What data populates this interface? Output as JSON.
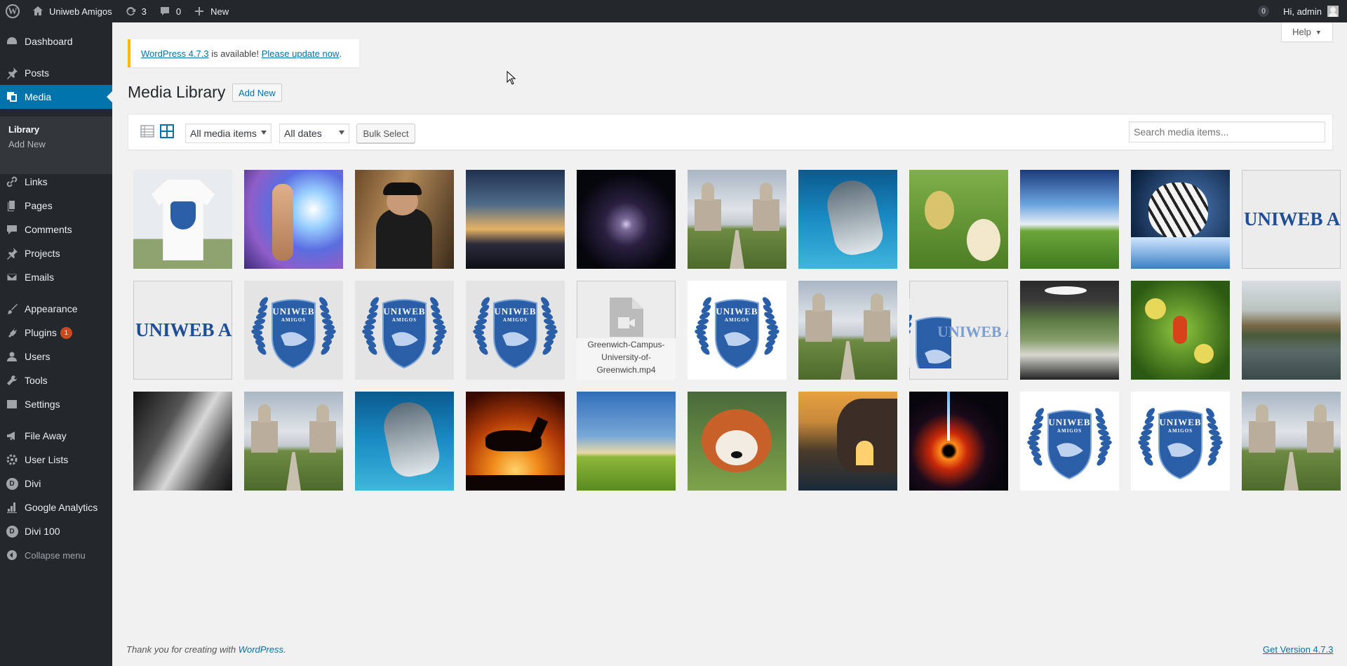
{
  "adminbar": {
    "site_name": "Uniweb Amigos",
    "updates_count": "3",
    "comments_count": "0",
    "new_label": "New",
    "notifications_count": "0",
    "greeting": "Hi, admin"
  },
  "sidebar": {
    "items": [
      {
        "label": "Dashboard",
        "icon": "dashboard-icon"
      },
      {
        "label": "Posts",
        "icon": "pin-icon"
      },
      {
        "label": "Media",
        "icon": "media-icon"
      },
      {
        "label": "Links",
        "icon": "link-icon"
      },
      {
        "label": "Pages",
        "icon": "pages-icon"
      },
      {
        "label": "Comments",
        "icon": "comment-icon"
      },
      {
        "label": "Projects",
        "icon": "pin-icon"
      },
      {
        "label": "Emails",
        "icon": "envelope-icon"
      },
      {
        "label": "Appearance",
        "icon": "paintbrush-icon"
      },
      {
        "label": "Plugins",
        "icon": "plug-icon"
      },
      {
        "label": "Users",
        "icon": "user-icon"
      },
      {
        "label": "Tools",
        "icon": "wrench-icon"
      },
      {
        "label": "Settings",
        "icon": "settings-icon"
      },
      {
        "label": "File Away",
        "icon": "megaphone-icon"
      },
      {
        "label": "User Lists",
        "icon": "gear-icon"
      },
      {
        "label": "Divi",
        "icon": "divi-icon"
      },
      {
        "label": "Google Analytics",
        "icon": "chart-icon"
      },
      {
        "label": "Divi 100",
        "icon": "divi-icon"
      },
      {
        "label": "Collapse menu",
        "icon": "collapse-icon"
      }
    ],
    "media_submenu": [
      "Library",
      "Add New"
    ],
    "plugins_badge": "1",
    "divi_letter": "D"
  },
  "help_label": "Help",
  "notice": {
    "link1": "WordPress 4.7.3",
    "text": " is available! ",
    "link2": "Please update now",
    "end": "."
  },
  "page": {
    "title": "Media Library",
    "add_new": "Add New"
  },
  "toolbar": {
    "filter_type": "All media items",
    "filter_date": "All dates",
    "bulk_select": "Bulk Select",
    "search_placeholder": "Search media items..."
  },
  "media_items": [
    {
      "kind": "tshirt"
    },
    {
      "kind": "fairy"
    },
    {
      "kind": "photographer"
    },
    {
      "kind": "sunset"
    },
    {
      "kind": "galaxy"
    },
    {
      "kind": "building"
    },
    {
      "kind": "shark"
    },
    {
      "kind": "ducks"
    },
    {
      "kind": "meadow"
    },
    {
      "kind": "tiger"
    },
    {
      "kind": "logo-text"
    },
    {
      "kind": "logo-text"
    },
    {
      "kind": "crest-grey"
    },
    {
      "kind": "crest-grey"
    },
    {
      "kind": "crest-grey"
    },
    {
      "kind": "video",
      "filename": "Greenwich-Campus-University-of-Greenwich.mp4"
    },
    {
      "kind": "crest-white"
    },
    {
      "kind": "building"
    },
    {
      "kind": "crest-text"
    },
    {
      "kind": "room"
    },
    {
      "kind": "beetle"
    },
    {
      "kind": "lake"
    },
    {
      "kind": "hands"
    },
    {
      "kind": "building"
    },
    {
      "kind": "shark"
    },
    {
      "kind": "horse"
    },
    {
      "kind": "field"
    },
    {
      "kind": "panda"
    },
    {
      "kind": "cliff"
    },
    {
      "kind": "blackhole"
    },
    {
      "kind": "crest-white"
    },
    {
      "kind": "crest-white"
    },
    {
      "kind": "building"
    }
  ],
  "logo_text": "UNIWEB AMIGOS",
  "crest_text": "UNIWEB",
  "crest_subtext": "AMIGOS",
  "footer": {
    "thanks": "Thank you for creating with ",
    "link": "WordPress",
    "end": ".",
    "version_link": "Get Version 4.7.3"
  },
  "colors": {
    "sidebar_bg": "#23282d",
    "accent": "#0073aa",
    "notice_border": "#ffb900",
    "badge": "#ca4a1f",
    "crest_blue": "#2a5ea7"
  }
}
